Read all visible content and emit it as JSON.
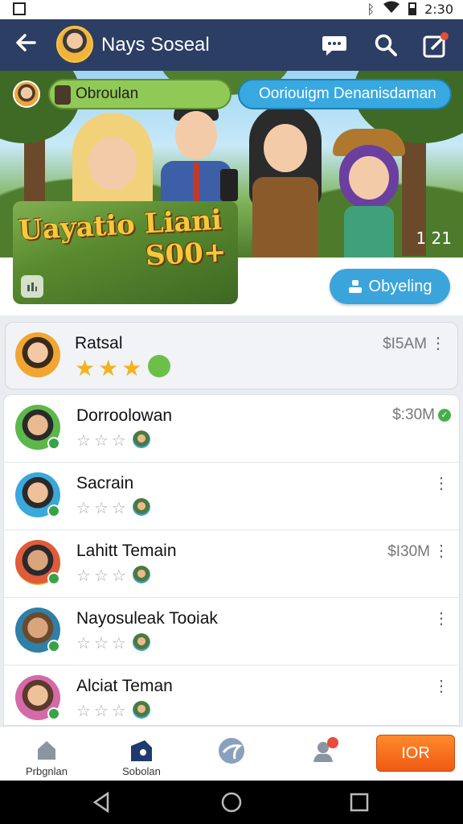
{
  "status_bar": {
    "time": "2:30",
    "icons": [
      "notification-icon",
      "bluetooth-icon",
      "wifi-icon",
      "battery-icon"
    ]
  },
  "app_bar": {
    "title": "Nays Soseal",
    "actions": [
      "chat-icon",
      "search-icon",
      "compose-icon"
    ]
  },
  "banner": {
    "pill_left": "Obroulan",
    "pill_right": "Ooriouigm Denanisdaman",
    "hero_line1": "Uayatio Liani",
    "hero_line2": "S00+",
    "side_text": "1 21",
    "follow_button": "Obyeling"
  },
  "featured": {
    "name": "Ratsal",
    "amount": "$I5AM",
    "stars": 3
  },
  "list": [
    {
      "name": "Dorroolowan",
      "amount": "$:30M",
      "verified": true,
      "stars": 0
    },
    {
      "name": "Sacrain",
      "amount": "",
      "verified": false,
      "stars": 0
    },
    {
      "name": "Lahitt Temain",
      "amount": "$I30M",
      "verified": false,
      "stars": 0
    },
    {
      "name": "Nayosuleak Tooiak",
      "amount": "",
      "verified": false,
      "stars": 0
    },
    {
      "name": "Alciat Teman",
      "amount": "",
      "verified": false,
      "stars": 0
    }
  ],
  "bottom_nav": {
    "items": [
      {
        "label": "Prbgnlan",
        "icon": "home-icon"
      },
      {
        "label": "Sobolan",
        "icon": "ticket-icon",
        "active": true
      },
      {
        "label": "",
        "icon": "globe-icon"
      },
      {
        "label": "",
        "icon": "friends-icon"
      }
    ],
    "cta": "IOR"
  },
  "colors": {
    "appbar": "#2c3e63",
    "accent_blue": "#3ba4db",
    "cta_orange": "#ee5a14",
    "star_gold": "#f3b21f",
    "online_green": "#37a347"
  }
}
